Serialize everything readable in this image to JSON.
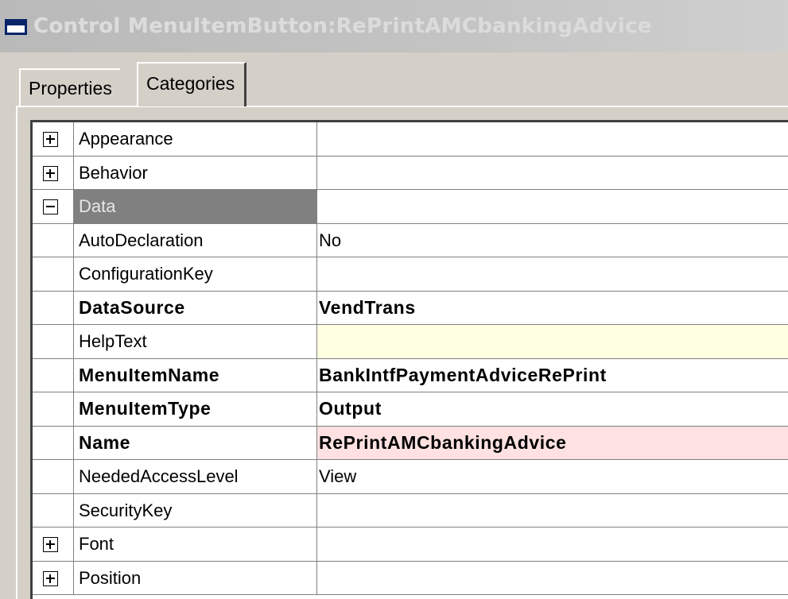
{
  "window": {
    "title": "Control MenuItemButton:RePrintAMCbankingAdvice"
  },
  "tabs": {
    "properties": "Properties",
    "categories": "Categories",
    "active": "Categories"
  },
  "rows": [
    {
      "expander": "plus",
      "name": "Appearance",
      "value": ""
    },
    {
      "expander": "plus",
      "name": "Behavior",
      "value": ""
    },
    {
      "expander": "minus",
      "name": "Data",
      "value": "",
      "selected": true
    },
    {
      "expander": "",
      "name": "AutoDeclaration",
      "value": "No"
    },
    {
      "expander": "",
      "name": "ConfigurationKey",
      "value": ""
    },
    {
      "expander": "",
      "name": "DataSource",
      "value": "VendTrans",
      "bold": true
    },
    {
      "expander": "",
      "name": "HelpText",
      "value": "",
      "highlight": "#ffffe1"
    },
    {
      "expander": "",
      "name": "MenuItemName",
      "value": "BankIntfPaymentAdviceRePrint",
      "bold": true
    },
    {
      "expander": "",
      "name": "MenuItemType",
      "value": "Output",
      "bold": true
    },
    {
      "expander": "",
      "name": "Name",
      "value": "RePrintAMCbankingAdvice",
      "bold": true,
      "highlight": "#ffe1e1"
    },
    {
      "expander": "",
      "name": "NeededAccessLevel",
      "value": "View"
    },
    {
      "expander": "",
      "name": "SecurityKey",
      "value": ""
    },
    {
      "expander": "plus",
      "name": "Font",
      "value": ""
    },
    {
      "expander": "plus",
      "name": "Position",
      "value": ""
    }
  ],
  "icons": {
    "window_icon": "form-window-icon",
    "expand": "expand-plus-icon",
    "collapse": "collapse-minus-icon"
  },
  "colors": {
    "selected_row": "#808080",
    "helptext_bg": "#ffffe1",
    "name_bg": "#ffe1e1"
  }
}
